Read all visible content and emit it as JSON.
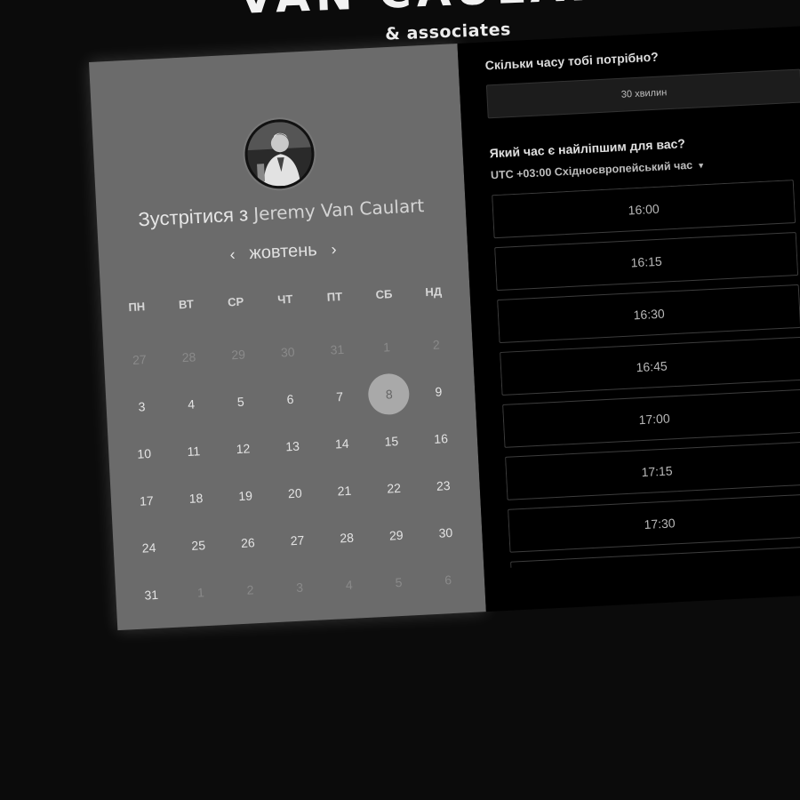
{
  "brand": {
    "name": "VAN CAULART",
    "subtitle": "& associates"
  },
  "host": {
    "meet_prefix": "Зустрітися з",
    "name": "Jeremy Van Caulart"
  },
  "calendar": {
    "month": "жовтень",
    "prev_icon": "chevron-left-icon",
    "next_icon": "chevron-right-icon",
    "weekdays": [
      "ПН",
      "ВТ",
      "СР",
      "ЧТ",
      "ПТ",
      "СБ",
      "НД"
    ],
    "days": [
      {
        "label": "27",
        "muted": true
      },
      {
        "label": "28",
        "muted": true
      },
      {
        "label": "29",
        "muted": true
      },
      {
        "label": "30",
        "muted": true
      },
      {
        "label": "31",
        "muted": true
      },
      {
        "label": "1",
        "muted": true
      },
      {
        "label": "2",
        "muted": true
      },
      {
        "label": "3"
      },
      {
        "label": "4"
      },
      {
        "label": "5"
      },
      {
        "label": "6"
      },
      {
        "label": "7"
      },
      {
        "label": "8",
        "selected": true
      },
      {
        "label": "9"
      },
      {
        "label": "10"
      },
      {
        "label": "11"
      },
      {
        "label": "12"
      },
      {
        "label": "13"
      },
      {
        "label": "14"
      },
      {
        "label": "15"
      },
      {
        "label": "16"
      },
      {
        "label": "17"
      },
      {
        "label": "18"
      },
      {
        "label": "19"
      },
      {
        "label": "20"
      },
      {
        "label": "21"
      },
      {
        "label": "22"
      },
      {
        "label": "23"
      },
      {
        "label": "24"
      },
      {
        "label": "25"
      },
      {
        "label": "26"
      },
      {
        "label": "27"
      },
      {
        "label": "28"
      },
      {
        "label": "29"
      },
      {
        "label": "30"
      },
      {
        "label": "31"
      },
      {
        "label": "1",
        "muted": true
      },
      {
        "label": "2",
        "muted": true
      },
      {
        "label": "3",
        "muted": true
      },
      {
        "label": "4",
        "muted": true
      },
      {
        "label": "5",
        "muted": true
      },
      {
        "label": "6",
        "muted": true
      }
    ]
  },
  "booking": {
    "duration_question": "Скільки часу тобі потрібно?",
    "duration_value": "30 хвилин",
    "time_question": "Який час є найліпшим для вас?",
    "timezone": "UTC +03:00 Східноєвропейський час",
    "slots": [
      "16:00",
      "16:15",
      "16:30",
      "16:45",
      "17:00",
      "17:15",
      "17:30",
      ""
    ]
  },
  "colors": {
    "page_bg": "#0b0b0b",
    "calendar_bg": "#6b6b6b",
    "slots_bg": "#000000",
    "selected_day": "#a9a9a9"
  }
}
